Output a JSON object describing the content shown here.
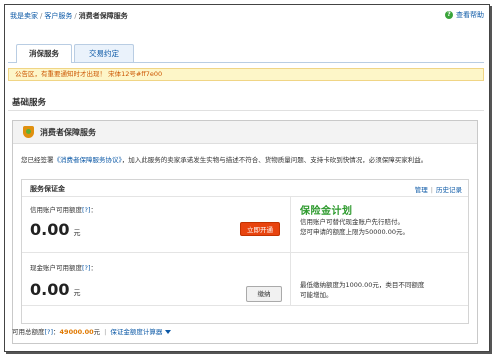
{
  "breadcrumb": {
    "items": [
      "我是卖家",
      "客户服务"
    ],
    "current": "消费者保障服务"
  },
  "help": {
    "label": "查看帮助",
    "icon": "help-icon"
  },
  "tabs": [
    {
      "label": "消保服务",
      "active": true
    },
    {
      "label": "交易约定",
      "active": false
    }
  ],
  "notice": {
    "text": "公告区，有重要通知时才出现！ 宋体12号#ff7e00",
    "color": "#ff7e00"
  },
  "section": {
    "title": "基础服务"
  },
  "panel": {
    "title": "消费者保障服务",
    "icon": "shield-icon",
    "agree_prefix": "您已经签署",
    "agree_link": "《消费者保障服务协议》",
    "agree_suffix": "，加入此服务的卖家承诺发生实物与描述不符合、货物质量问题、支持卡砍到快情况，必须保障买家利益。"
  },
  "deposit": {
    "title": "服务保证金",
    "links": {
      "manage": "管理",
      "history": "历史记录"
    },
    "credit": {
      "label": "信用账户可用额度",
      "q": "[?]",
      "colon": "：",
      "amount": "0.00",
      "unit": "元",
      "button": "立即开通"
    },
    "promo": {
      "logo": "保险金计划",
      "line1": "信用账户可替代现金账户先行赔付。",
      "line2": "您可申请的额度上限为50000.00元。"
    },
    "cash": {
      "label": "现金账户可用额度",
      "q": "[?]",
      "colon": "：",
      "amount": "0.00",
      "unit": "元",
      "button": "缴纳"
    },
    "limit": {
      "line1": "最低缴纳额度为1000.00元，类目不同额度",
      "line2": "可能增加。"
    }
  },
  "footer": {
    "label": "可用总额度",
    "q": "[?]",
    "colon": "：",
    "total": "49000.00",
    "unit": "元",
    "calc": "保证金额度计算器"
  },
  "colors": {
    "accent": "#0b58a6",
    "danger": "#e8440f",
    "notice": "#ff7e00",
    "brand_green": "#2d9a2d"
  }
}
